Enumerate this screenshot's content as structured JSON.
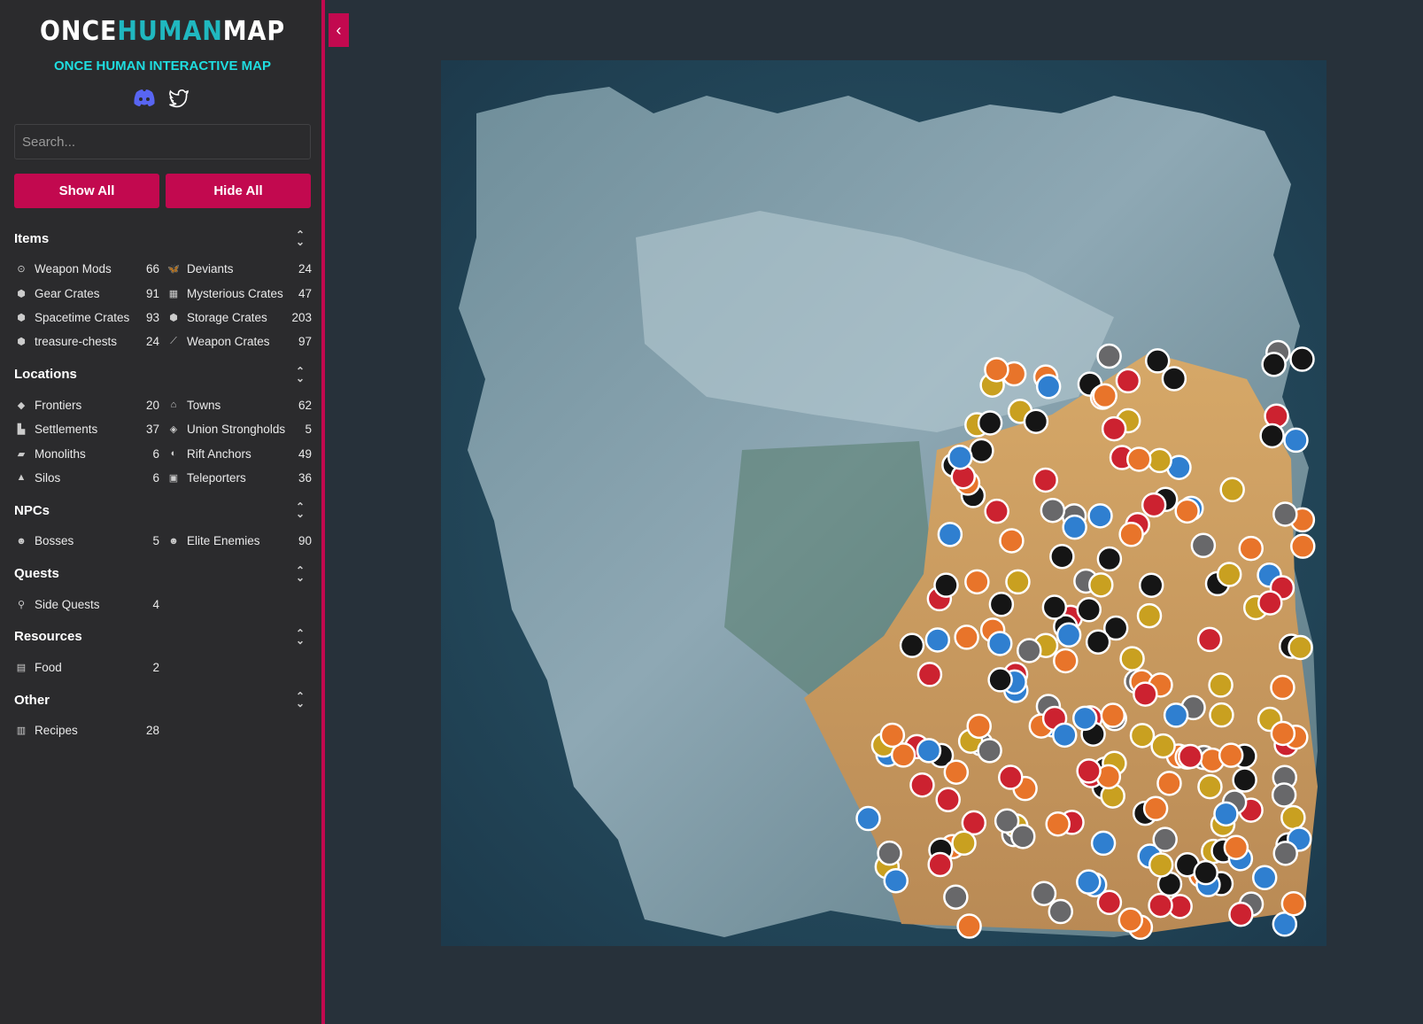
{
  "brand": {
    "logo_parts": [
      "ONCE",
      "HUMAN",
      "MAP"
    ],
    "subtitle": "ONCE HUMAN INTERACTIVE MAP"
  },
  "social": [
    "discord-icon",
    "twitter-icon"
  ],
  "search": {
    "placeholder": "Search...",
    "value": ""
  },
  "buttons": {
    "show_all": "Show All",
    "hide_all": "Hide All"
  },
  "sections": [
    {
      "title": "Items",
      "items": [
        {
          "label": "Weapon Mods",
          "count": "66",
          "icon": "⊙"
        },
        {
          "label": "Deviants",
          "count": "24",
          "icon": "🦋"
        },
        {
          "label": "Gear Crates",
          "count": "91",
          "icon": "⬢"
        },
        {
          "label": "Mysterious Crates",
          "count": "47",
          "icon": "▦"
        },
        {
          "label": "Spacetime Crates",
          "count": "93",
          "icon": "⬢"
        },
        {
          "label": "Storage Crates",
          "count": "203",
          "icon": "⬢"
        },
        {
          "label": "treasure-chests",
          "count": "24",
          "icon": "⬢"
        },
        {
          "label": "Weapon Crates",
          "count": "97",
          "icon": "⟋"
        }
      ]
    },
    {
      "title": "Locations",
      "items": [
        {
          "label": "Frontiers",
          "count": "20",
          "icon": "◆"
        },
        {
          "label": "Towns",
          "count": "62",
          "icon": "⌂"
        },
        {
          "label": "Settlements",
          "count": "37",
          "icon": "▙"
        },
        {
          "label": "Union Strongholds",
          "count": "5",
          "icon": "◈"
        },
        {
          "label": "Monoliths",
          "count": "6",
          "icon": "▰"
        },
        {
          "label": "Rift Anchors",
          "count": "49",
          "icon": "◐"
        },
        {
          "label": "Silos",
          "count": "6",
          "icon": "▲"
        },
        {
          "label": "Teleporters",
          "count": "36",
          "icon": "▣"
        }
      ]
    },
    {
      "title": "NPCs",
      "items": [
        {
          "label": "Bosses",
          "count": "5",
          "icon": "☻"
        },
        {
          "label": "Elite Enemies",
          "count": "90",
          "icon": "☻"
        }
      ]
    },
    {
      "title": "Quests",
      "items": [
        {
          "label": "Side Quests",
          "count": "4",
          "icon": "⚲"
        }
      ]
    },
    {
      "title": "Resources",
      "items": [
        {
          "label": "Food",
          "count": "2",
          "icon": "▤"
        }
      ]
    },
    {
      "title": "Other",
      "items": [
        {
          "label": "Recipes",
          "count": "28",
          "icon": "▥"
        }
      ]
    }
  ],
  "marker_colors": {
    "orange": "#e8742a",
    "gray": "#68686a",
    "blue": "#2f7fd0",
    "black": "#151515",
    "red": "#cc2230",
    "yellow": "#c9a020"
  }
}
